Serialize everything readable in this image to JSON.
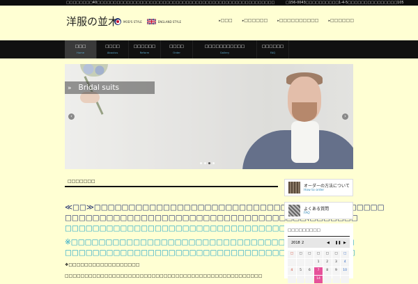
{
  "topbar": {
    "left": "□□□□□□□□40□□□□□□□□□□□□□□□□□□□□□□□□□□□□□□□□□□□□□□□□□□□□□□□□□□□□□□",
    "right": "□156-0043□□□□□□□□□□1-4-5□□□□□□□□□□□□□□□105"
  },
  "site": {
    "logo": "洋服の並木",
    "mods_label": "MOD'S STYLE",
    "england_label": "ENGLAND STYLE"
  },
  "topnav": [
    "□□□",
    "□□□□□□",
    "□□□□□□□□□□",
    "□□□□□□"
  ],
  "mainnav": [
    {
      "label": "□□□",
      "sub": "Home",
      "active": true
    },
    {
      "label": "□□□□",
      "sub": "Aboutus"
    },
    {
      "label": "□□□□□□",
      "sub": "Reform"
    },
    {
      "label": "□□□□",
      "sub": "Order"
    },
    {
      "label": "□□□□□□□□□□□",
      "sub": "Gallery"
    },
    {
      "label": "□□□□□□",
      "sub": "FAQ"
    }
  ],
  "slider": {
    "quote": "»",
    "caption": "Bridal suits",
    "prev": "‹",
    "next": "›",
    "dots": 4,
    "active_dot": 2
  },
  "news": {
    "heading": "□□□□□□□",
    "lines": [
      "≪□□≫□□□□□□□□□□□□□□□□□□□□□□□□□□□□□□□□□□□□□□□□□□",
      "□□□□□□□□□□□□□□□□□□□□□□□□□□□□□□□□□□□(□□□□□□□",
      "□□□□□□□□□□□□□□□□□□□□□□□□□□□□□□□□□□□□□□□□□",
      "※□□□□□□□□□□□□□□□□□□□□□□□□□□□□□□□□□□□□□□□□□",
      "□□□□□□□□□□□□□□□□□□□□□□□□□□□□□□□□□□□□□□□□□□",
      "□□□□□□□□□□□□□□□□□□□□□□□□□□□□□□□"
    ],
    "note1": "❖□□□□□□□□□□□□□□□□□□",
    "note2": "□□□□□□□□□□□□□□□□□□□□□□□□□□□□□□□□□□□□□□□□□□□□□□□□□□"
  },
  "sidebar": {
    "order": {
      "title": "オーダーの方法について",
      "sub": "How to order"
    },
    "faq": {
      "title": "よくある質問",
      "sub": "FAQ"
    },
    "calendar_heading": "□□□□□□□□□",
    "calendar": {
      "year": "2018",
      "month": "2",
      "weekdays": [
        "□",
        "□",
        "□",
        "□",
        "□",
        "□",
        "□"
      ],
      "rows": [
        [
          "",
          "",
          "",
          "1",
          "2",
          "3",
          "4"
        ],
        [
          "4",
          "5",
          "6",
          "7",
          "8",
          "9",
          "10"
        ],
        [
          "",
          "",
          "",
          "14",
          "",
          "",
          ""
        ]
      ],
      "highlight": [
        "7",
        "14"
      ]
    }
  },
  "colors": {
    "background": "#ffffd3",
    "accent_cyan": "#1aa3c9",
    "accent_navy": "#1f2d6e",
    "highlight_pink": "#e6529a"
  }
}
